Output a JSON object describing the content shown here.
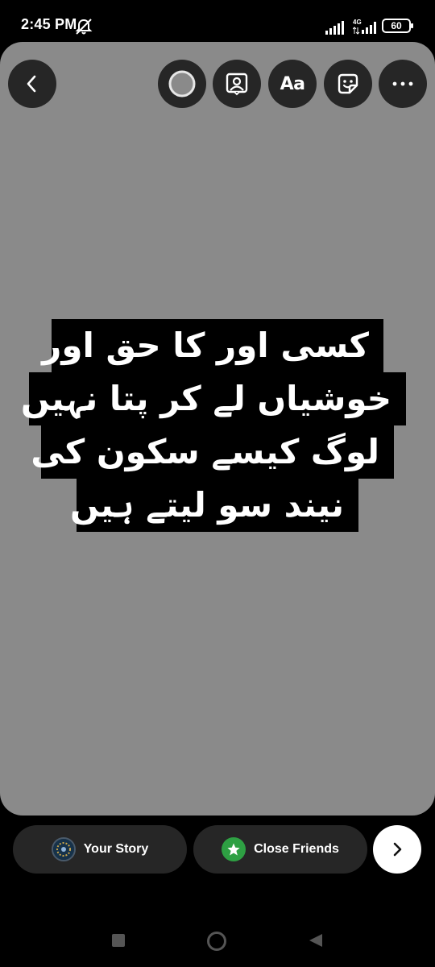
{
  "status_bar": {
    "time": "2:45 PM",
    "network": "4G",
    "battery": "60"
  },
  "toolbar": {
    "back_icon": "chevron-left-icon",
    "color_icon": "color-circle-icon",
    "profile_icon": "portrait-icon",
    "text_label": "Aa",
    "sticker_icon": "sticker-icon",
    "more_icon": "more-horizontal-icon"
  },
  "story_text": {
    "lines": [
      "کسی اور کا حق اور",
      "خوشیاں لے کر پتا نہیں",
      "لوگ کیسے سکون کی",
      "نیند سو لیتے ہیں"
    ],
    "text_color": "#ffffff",
    "highlight_color": "#000000"
  },
  "canvas": {
    "background_color": "#8a8a8a"
  },
  "share": {
    "your_story_label": "Your Story",
    "close_friends_label": "Close Friends",
    "close_friends_color": "#2ea043",
    "next_icon": "chevron-right-icon"
  },
  "nav_bar": {
    "recent_icon": "square-icon",
    "home_icon": "circle-icon",
    "back_icon": "triangle-back-icon"
  }
}
